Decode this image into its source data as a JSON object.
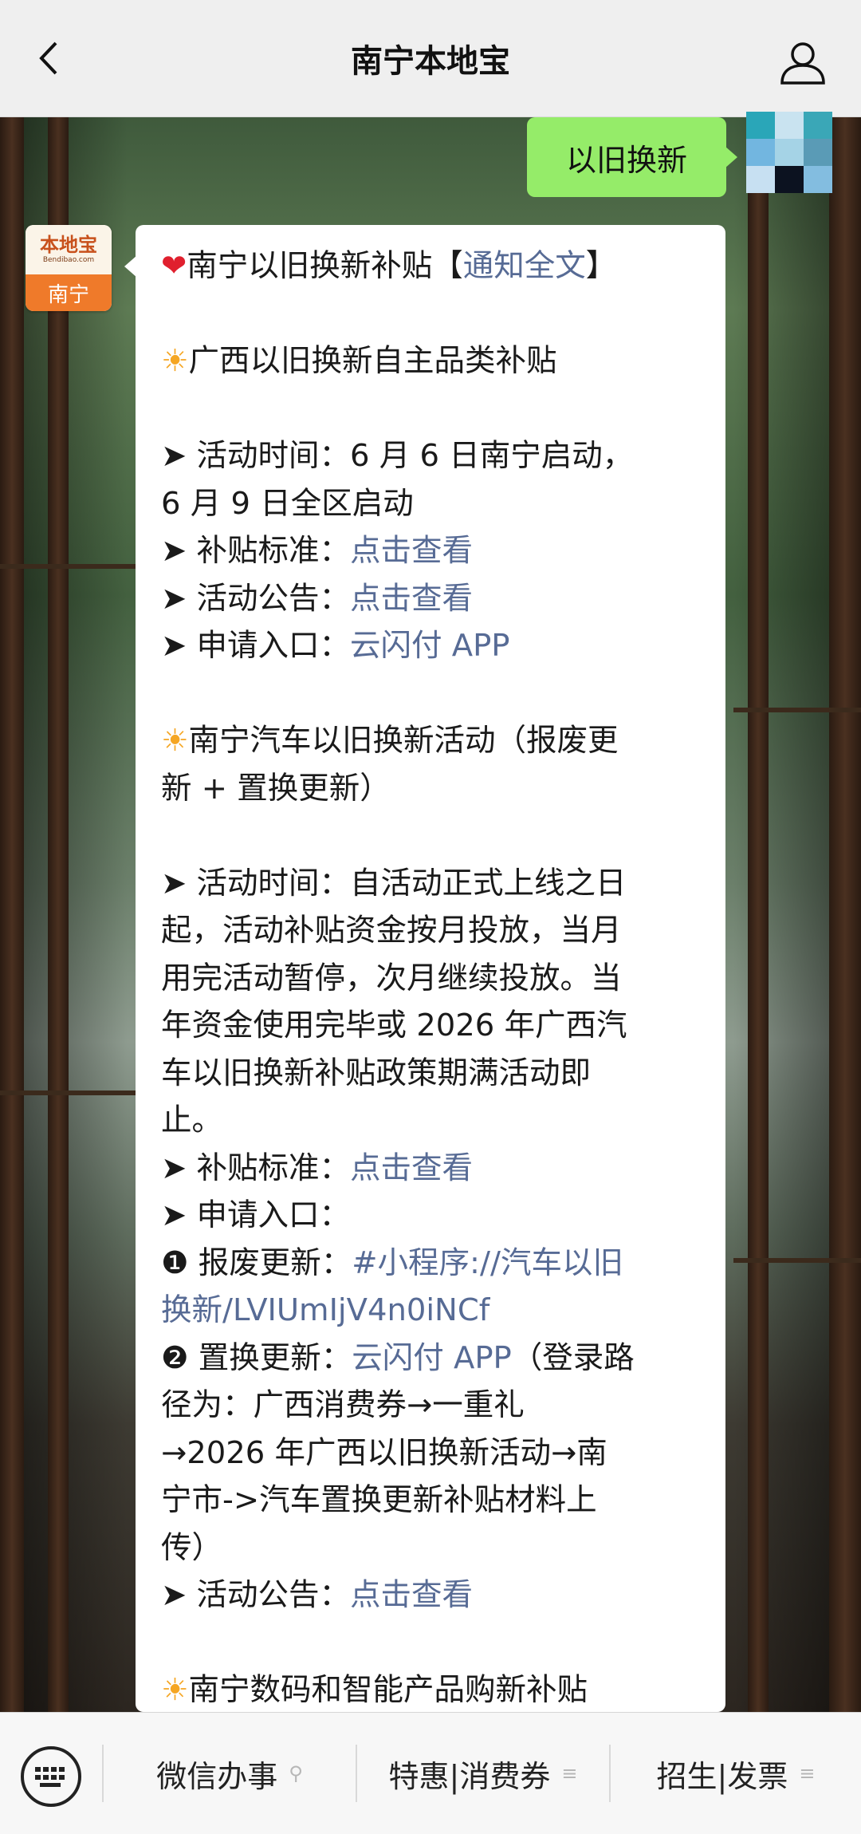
{
  "header": {
    "title": "南宁本地宝",
    "back_icon": "chevron-left-icon",
    "profile_icon": "person-icon"
  },
  "sent_message": {
    "text": "以旧换新"
  },
  "bot_avatar": {
    "logo_text": "本地宝",
    "logo_sub": "Bendibao.com",
    "city": "南宁"
  },
  "message": {
    "title": {
      "emoji": "❤",
      "text": "南宁以旧换新补贴【",
      "link": "通知全文",
      "end": "】"
    },
    "section1": {
      "emoji": "☀",
      "heading": "广西以旧换新自主品类补贴",
      "time_label": "➤ 活动时间：",
      "time_line1": "6 月 6 日南宁启动，",
      "time_line2": "6 月 9 日全区启动",
      "standard_label": "➤ 补贴标准：",
      "standard_link": "点击查看",
      "notice_label": "➤ 活动公告：",
      "notice_link": "点击查看",
      "apply_label": "➤ 申请入口：",
      "apply_link": "云闪付 APP"
    },
    "section2": {
      "emoji": "☀",
      "heading_line1": "南宁汽车以旧换新活动（报废更",
      "heading_line2": "新 + 置换更新）",
      "time_lines": [
        "➤ 活动时间：自活动正式上线之日",
        "起，活动补贴资金按月投放，当月",
        "用完活动暂停，次月继续投放。当",
        "年资金使用完毕或 2026 年广西汽",
        "车以旧换新补贴政策期满活动即",
        "止。"
      ],
      "standard_label": "➤ 补贴标准：",
      "standard_link": "点击查看",
      "apply_label": "➤ 申请入口：",
      "scrap_label": "❶ 报废更新：",
      "scrap_link_line1": "#小程序://汽车以旧",
      "scrap_link_line2": "换新/LVIUmIjV4n0iNCf",
      "replace_label": "❷ 置换更新：",
      "replace_link": "云闪付 APP",
      "replace_path_start": "（登录路",
      "path_lines": [
        "径为：广西消费券→一重礼",
        "→2026 年广西以旧换新活动→南",
        "宁市->汽车置换更新补贴材料上",
        "传）"
      ],
      "notice_label": "➤ 活动公告：",
      "notice_link": "点击查看"
    },
    "section3": {
      "emoji": "☀",
      "heading": "南宁数码和智能产品购新补贴"
    }
  },
  "bottom_menu": {
    "keyboard_icon": "keyboard-icon",
    "items": [
      {
        "label": "微信办事",
        "icon": "link-icon"
      },
      {
        "label": "特惠|消费券",
        "icon": "menu-lines-icon"
      },
      {
        "label": "招生|发票",
        "icon": "menu-lines-icon"
      }
    ]
  }
}
